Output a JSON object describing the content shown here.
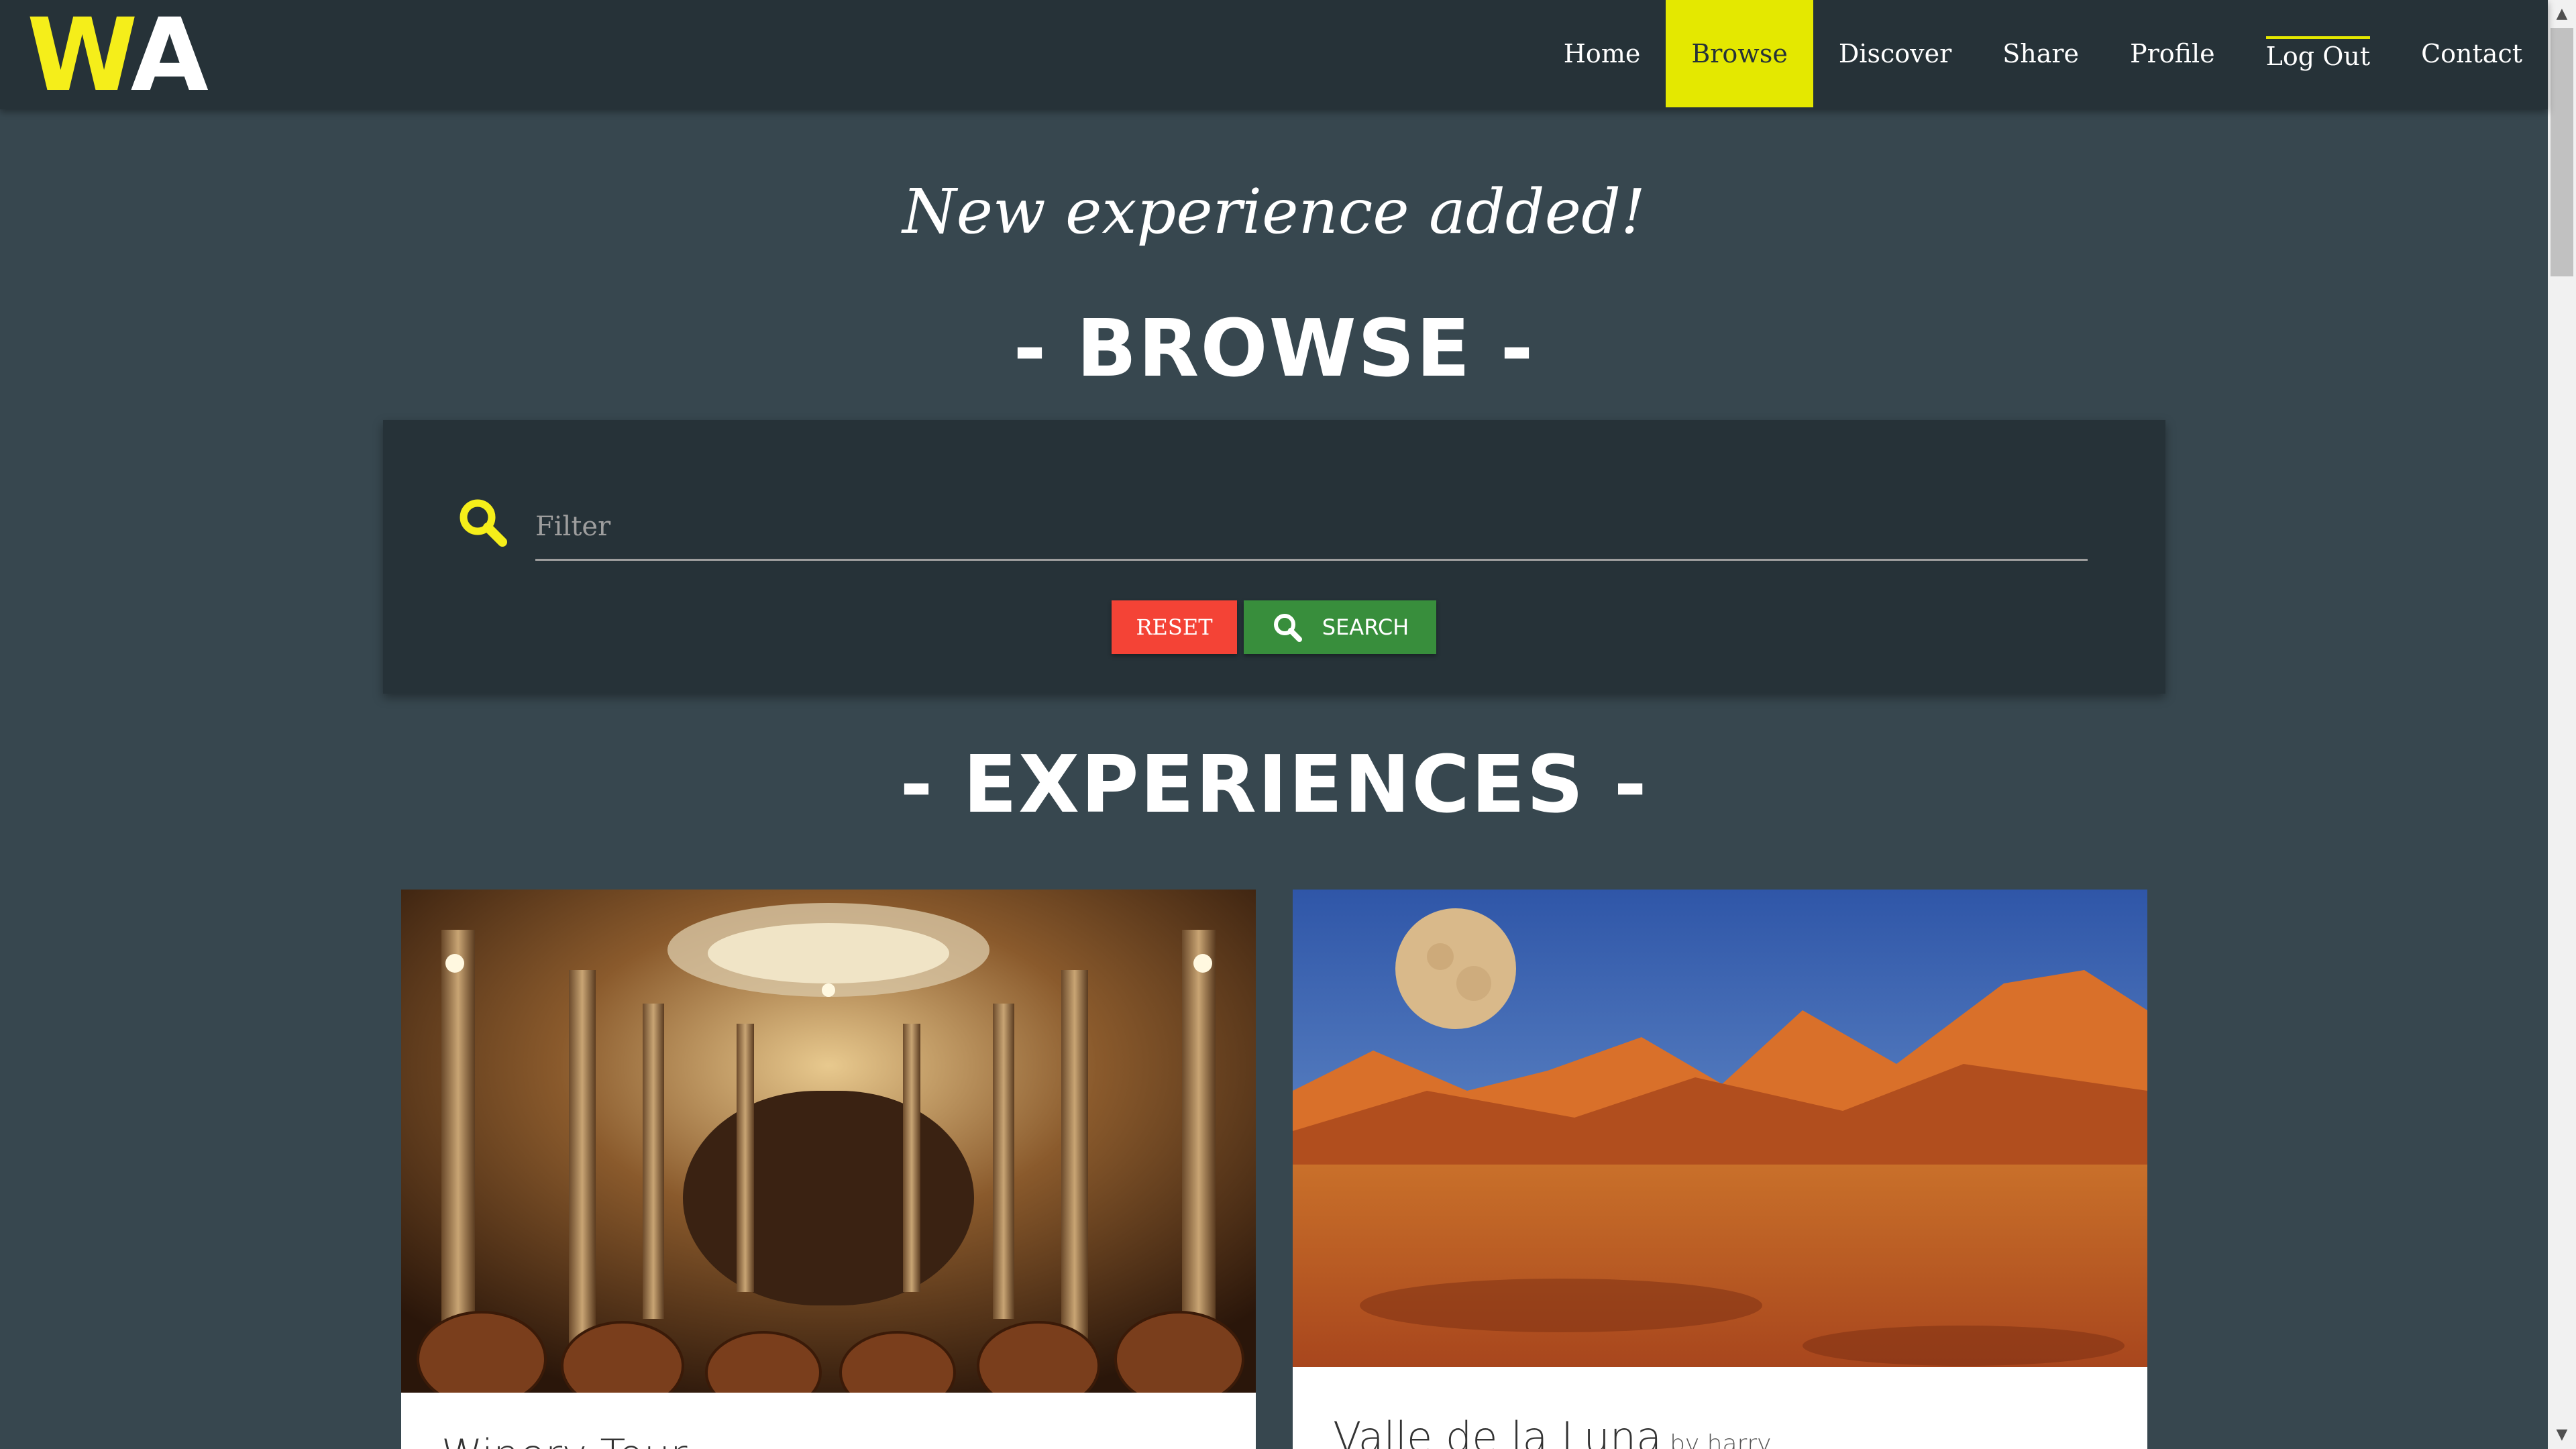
{
  "logo": {
    "first": "W",
    "second": "A"
  },
  "nav": {
    "items": [
      {
        "label": "Home"
      },
      {
        "label": "Browse"
      },
      {
        "label": "Discover"
      },
      {
        "label": "Share"
      },
      {
        "label": "Profile"
      },
      {
        "label": "Log Out"
      },
      {
        "label": "Contact"
      }
    ],
    "active": "Browse"
  },
  "flash_message": "New experience added!",
  "browse": {
    "heading": "- BROWSE -",
    "filter_placeholder": "Filter",
    "reset_label": "RESET",
    "search_label": "SEARCH"
  },
  "experiences": {
    "heading": "- EXPERIENCES -",
    "cards": [
      {
        "title": "Winery Tour",
        "image": "winery-barrel-cellar"
      },
      {
        "title": "Valle de la Luna",
        "author": "by harry",
        "image": "desert-moon-landscape"
      }
    ]
  },
  "colors": {
    "accent": "#e4e800",
    "logo_yellow": "#f5ee1a",
    "nav_bg": "#263238",
    "page_bg": "#37474f",
    "reset": "#f44336",
    "search": "#388e3c"
  }
}
